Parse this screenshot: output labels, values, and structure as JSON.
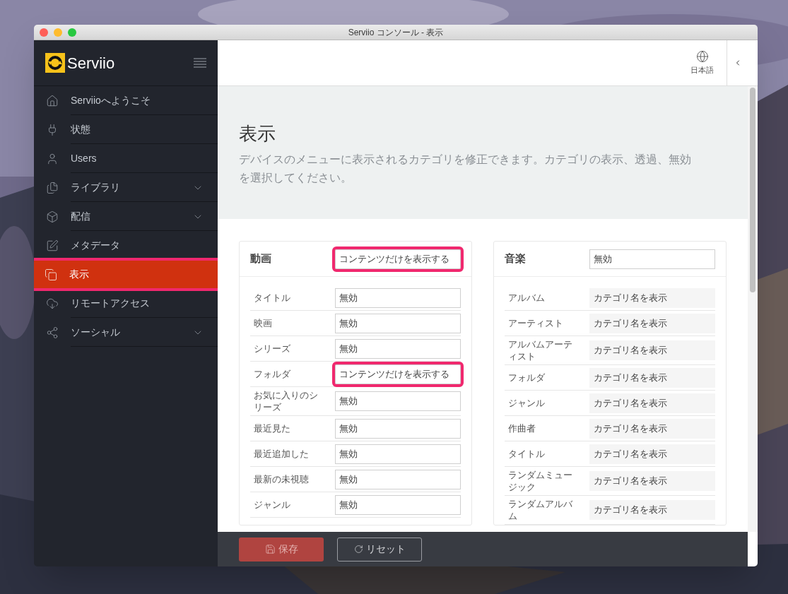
{
  "window": {
    "title": "Serviio コンソール - 表示"
  },
  "sidebar": {
    "logo": "Serviio",
    "items": [
      {
        "label": "Serviioへようこそ",
        "expandable": false,
        "selected": false,
        "highlighted": false
      },
      {
        "label": "状態",
        "expandable": false,
        "selected": false,
        "highlighted": false
      },
      {
        "label": "Users",
        "expandable": false,
        "selected": false,
        "highlighted": false
      },
      {
        "label": "ライブラリ",
        "expandable": true,
        "selected": false,
        "highlighted": false
      },
      {
        "label": "配信",
        "expandable": true,
        "selected": false,
        "highlighted": false
      },
      {
        "label": "メタデータ",
        "expandable": false,
        "selected": false,
        "highlighted": false
      },
      {
        "label": "表示",
        "expandable": false,
        "selected": true,
        "highlighted": true
      },
      {
        "label": "リモートアクセス",
        "expandable": false,
        "selected": false,
        "highlighted": false
      },
      {
        "label": "ソーシャル",
        "expandable": true,
        "selected": false,
        "highlighted": false
      }
    ]
  },
  "topbar": {
    "language": "日本語"
  },
  "page": {
    "title": "表示",
    "description": "デバイスのメニューに表示されるカテゴリを修正できます。カテゴリの表示、透過、無効を選択してください。"
  },
  "sections": [
    {
      "title": "動画",
      "value": "コンテンツだけを表示する",
      "highlighted": true,
      "disabled": false,
      "rows": [
        {
          "label": "タイトル",
          "value": "無効",
          "highlighted": false,
          "disabled": false
        },
        {
          "label": "映画",
          "value": "無効",
          "highlighted": false,
          "disabled": false
        },
        {
          "label": "シリーズ",
          "value": "無効",
          "highlighted": false,
          "disabled": false
        },
        {
          "label": "フォルダ",
          "value": "コンテンツだけを表示する",
          "highlighted": true,
          "disabled": false
        },
        {
          "label": "お気に入りのシリーズ",
          "value": "無効",
          "highlighted": false,
          "disabled": false
        },
        {
          "label": "最近見た",
          "value": "無効",
          "highlighted": false,
          "disabled": false
        },
        {
          "label": "最近追加した",
          "value": "無効",
          "highlighted": false,
          "disabled": false
        },
        {
          "label": "最新の未視聴",
          "value": "無効",
          "highlighted": false,
          "disabled": false
        },
        {
          "label": "ジャンル",
          "value": "無効",
          "highlighted": false,
          "disabled": false
        }
      ]
    },
    {
      "title": "音楽",
      "value": "無効",
      "highlighted": false,
      "disabled": false,
      "rows": [
        {
          "label": "アルバム",
          "value": "カテゴリ名を表示",
          "highlighted": false,
          "disabled": true
        },
        {
          "label": "アーティスト",
          "value": "カテゴリ名を表示",
          "highlighted": false,
          "disabled": true
        },
        {
          "label": "アルバムアーティスト",
          "value": "カテゴリ名を表示",
          "highlighted": false,
          "disabled": true
        },
        {
          "label": "フォルダ",
          "value": "カテゴリ名を表示",
          "highlighted": false,
          "disabled": true
        },
        {
          "label": "ジャンル",
          "value": "カテゴリ名を表示",
          "highlighted": false,
          "disabled": true
        },
        {
          "label": "作曲者",
          "value": "カテゴリ名を表示",
          "highlighted": false,
          "disabled": true
        },
        {
          "label": "タイトル",
          "value": "カテゴリ名を表示",
          "highlighted": false,
          "disabled": true
        },
        {
          "label": "ランダムミュージック",
          "value": "カテゴリ名を表示",
          "highlighted": false,
          "disabled": true
        },
        {
          "label": "ランダムアルバム",
          "value": "カテゴリ名を表示",
          "highlighted": false,
          "disabled": true
        }
      ]
    }
  ],
  "footer": {
    "buttons": [
      {
        "kind": "save",
        "label": "保存"
      },
      {
        "kind": "reset",
        "label": "リセット"
      }
    ]
  }
}
